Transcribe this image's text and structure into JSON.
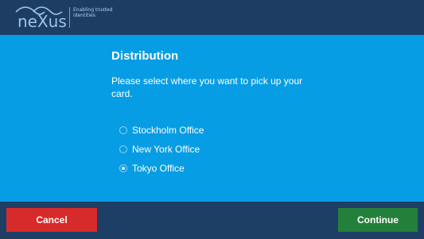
{
  "app": {
    "brand_name": "neXus",
    "brand_tagline": "Enabling trusted identities",
    "colors": {
      "header": "#1d3d63",
      "content": "#079de4",
      "footer": "#1e3f65",
      "cancel": "#d72a2b",
      "continue": "#23803a"
    }
  },
  "page": {
    "title": "Distribution",
    "description": "Please select where you want to pick up your card."
  },
  "options": [
    {
      "label": "Stockholm Office",
      "selected": false
    },
    {
      "label": "New York Office",
      "selected": false
    },
    {
      "label": "Tokyo Office",
      "selected": true
    }
  ],
  "footer": {
    "cancel_label": "Cancel",
    "continue_label": "Continue"
  }
}
